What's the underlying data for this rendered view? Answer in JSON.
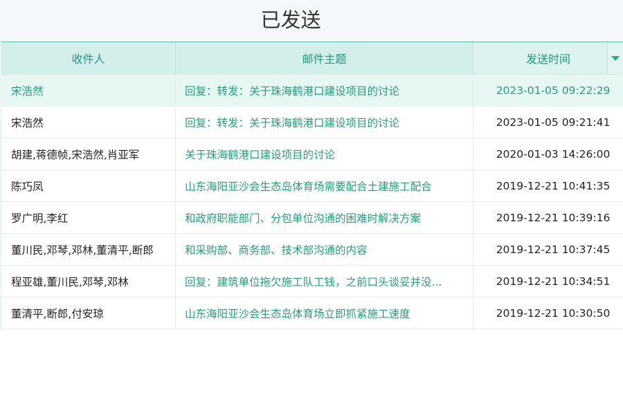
{
  "page": {
    "title": "已发送"
  },
  "table": {
    "columns": [
      "收件人",
      "邮件主题",
      "发送时间"
    ],
    "rows": [
      {
        "recipients": "宋浩然",
        "subject": "回复：转发：关于珠海鹤港口建设项目的讨论",
        "time": "2023-01-05 09:22:29",
        "selected": true
      },
      {
        "recipients": "宋浩然",
        "subject": "回复：转发：关于珠海鹤港口建设项目的讨论",
        "time": "2023-01-05 09:21:41"
      },
      {
        "recipients": "胡建,蒋德帧,宋浩然,肖亚军",
        "subject": "关于珠海鹤港口建设项目的讨论",
        "time": "2020-01-03 14:26:00"
      },
      {
        "recipients": "陈巧凤",
        "subject": "山东海阳亚沙会生态岛体育场需要配合土建施工配合",
        "time": "2019-12-21 10:41:35"
      },
      {
        "recipients": "罗广明,李红",
        "subject": "和政府职能部门、分包单位沟通的困难时解决方案",
        "time": "2019-12-21 10:39:16"
      },
      {
        "recipients": "董川民,邓琴,邓林,董清平,断郎",
        "subject": "和采购部、商务部、技术部沟通的内容",
        "time": "2019-12-21 10:37:45"
      },
      {
        "recipients": "程亚雄,董川民,邓琴,邓林",
        "subject": "回复：建筑单位拖欠施工队工钱，之前口头谈妥并没...",
        "time": "2019-12-21 10:34:51"
      },
      {
        "recipients": "董清平,断郎,付安琼",
        "subject": "山东海阳亚沙会生态岛体育场立即抓紧施工速度",
        "time": "2019-12-21 10:30:50"
      }
    ],
    "sort_icon": "caret-down-icon"
  },
  "colors": {
    "accent": "#1fb58c",
    "header_bg": "#d4efeb",
    "selected_row_bg": "#e6f7f4",
    "subject_text": "#21a07f"
  }
}
